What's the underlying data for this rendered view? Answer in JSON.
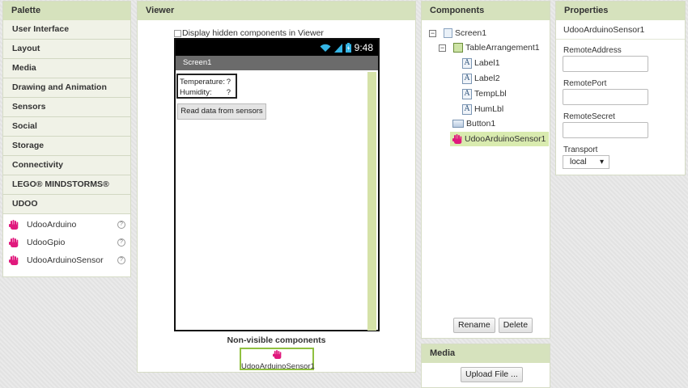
{
  "palette": {
    "title": "Palette",
    "categories": [
      "User Interface",
      "Layout",
      "Media",
      "Drawing and Animation",
      "Sensors",
      "Social",
      "Storage",
      "Connectivity",
      "LEGO® MINDSTORMS®",
      "UDOO"
    ],
    "udoo_items": [
      "UdooArduino",
      "UdooGpio",
      "UdooArduinoSensor"
    ],
    "help_icon": "?"
  },
  "viewer": {
    "title": "Viewer",
    "hidden_checkbox_label": "Display hidden components in Viewer",
    "status_time": "9:48",
    "screen_title": "Screen1",
    "table": [
      {
        "label": "Temperature:",
        "value": "?"
      },
      {
        "label": "Humidity:",
        "value": "?"
      }
    ],
    "button_label": "Read data from sensors",
    "nonvisible_title": "Non-visible components",
    "nonvisible_item": "UdooArduinoSensor1"
  },
  "components": {
    "title": "Components",
    "tree": {
      "screen": "Screen1",
      "table_arrangement": "TableArrangement1",
      "labels": [
        "Label1",
        "Label2",
        "TempLbl",
        "HumLbl"
      ],
      "button": "Button1",
      "sensor": "UdooArduinoSensor1"
    },
    "toggle_symbol": "−",
    "label_icon_letter": "A",
    "rename_label": "Rename",
    "delete_label": "Delete"
  },
  "media": {
    "title": "Media",
    "upload_label": "Upload File ..."
  },
  "properties": {
    "title": "Properties",
    "component_name": "UdooArduinoSensor1",
    "fields": [
      "RemoteAddress",
      "RemotePort",
      "RemoteSecret"
    ],
    "transport_label": "Transport",
    "transport_value": "local"
  },
  "colors": {
    "header_bg": "#d6e2bd",
    "selection_bg": "#d9ebaf",
    "nonvisible_border": "#90c040",
    "hand_icon": "#e0197d"
  }
}
